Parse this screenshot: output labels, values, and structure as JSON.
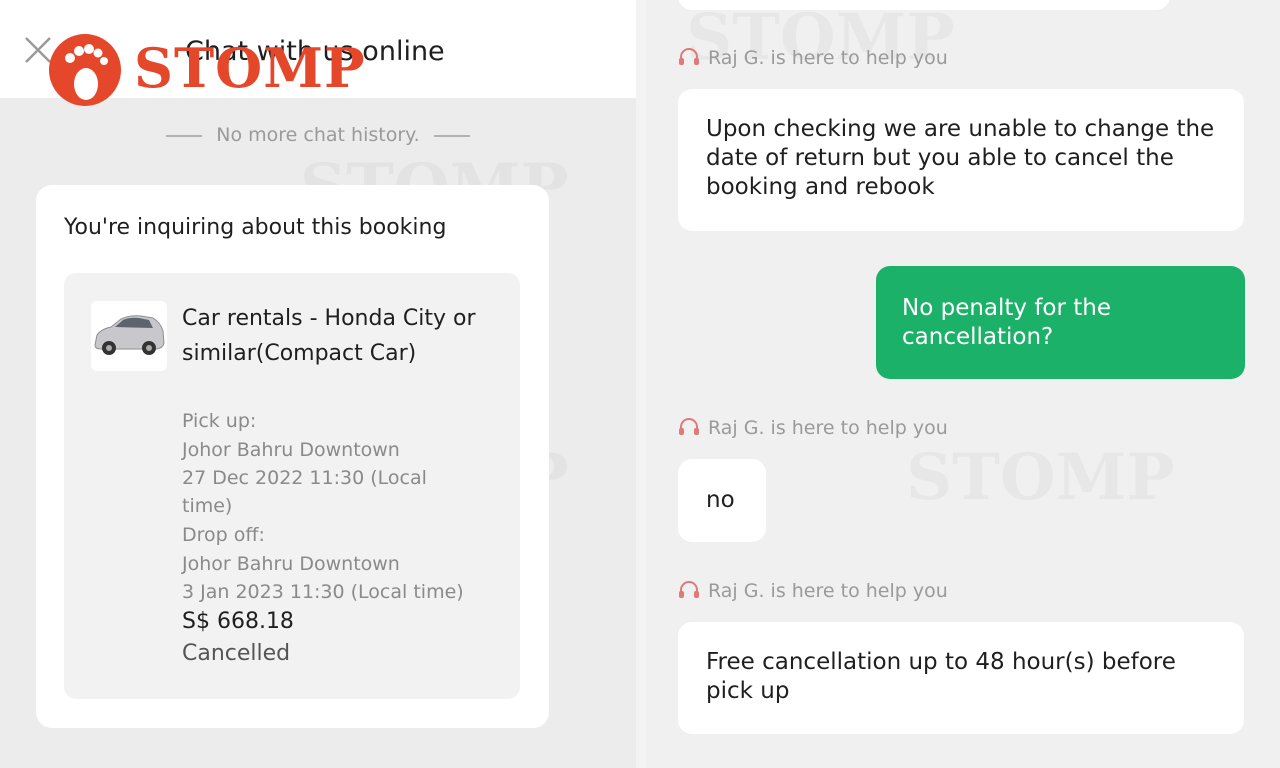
{
  "left": {
    "logo_text": "STOMP",
    "header_title": "Chat with us online",
    "history_note": "No more chat history.",
    "booking": {
      "heading": "You're inquiring about this booking",
      "car_name": "Car rentals - Honda City or similar(Compact Car)",
      "pickup_label": "Pick up:",
      "pickup_location": "Johor Bahru Downtown",
      "pickup_time_1": "27 Dec 2022 11:30 (Local",
      "pickup_time_2": "time)",
      "dropoff_label": "Drop off:",
      "dropoff_location": "Johor Bahru Downtown",
      "dropoff_time": "3 Jan 2023 11:30 (Local time)",
      "price": "S$ 668.18",
      "status": "Cancelled"
    }
  },
  "right": {
    "agent_label": "Raj G. is here to help you",
    "messages": [
      {
        "from": "agent",
        "text": "Upon checking we are unable to change the date of return but you able to cancel the booking and rebook"
      },
      {
        "from": "user",
        "text": "No penalty for the cancellation?"
      },
      {
        "from": "agent",
        "text": "no"
      },
      {
        "from": "agent",
        "text": "Free cancellation up to 48 hour(s) before pick up"
      }
    ]
  },
  "colors": {
    "brand": "#e4472a",
    "user_bubble": "#1cb169",
    "agent_icon": "#e07a7a"
  },
  "icons": [
    "close-icon",
    "stomp-logo",
    "car-thumbnail",
    "headset-icon"
  ]
}
